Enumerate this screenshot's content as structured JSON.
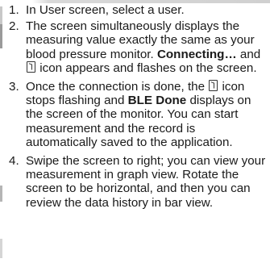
{
  "steps": [
    {
      "num": "1.",
      "text": "In User screen, select a user."
    },
    {
      "num": "2.",
      "text_a": "The screen simultaneously displays the measuring value exactly the same as your blood pressure monitor. ",
      "bold_a": "Connecting…",
      "text_b": " and ",
      "icon": "bluetooth-device-icon",
      "text_c": " icon appears and flashes on the screen."
    },
    {
      "num": "3.",
      "text_a": "Once the connection is done, the ",
      "icon": "bluetooth-device-icon",
      "text_b": " icon stops flashing and ",
      "bold_a": "BLE Done",
      "text_c": " displays on the screen of the monitor. You can start measurement and the record is automatically saved to the application."
    },
    {
      "num": "4.",
      "text": "Swipe the screen to right; you can view your measurement in graph view. Rotate the screen to be horizontal, and then you can review the data history in bar view."
    }
  ]
}
